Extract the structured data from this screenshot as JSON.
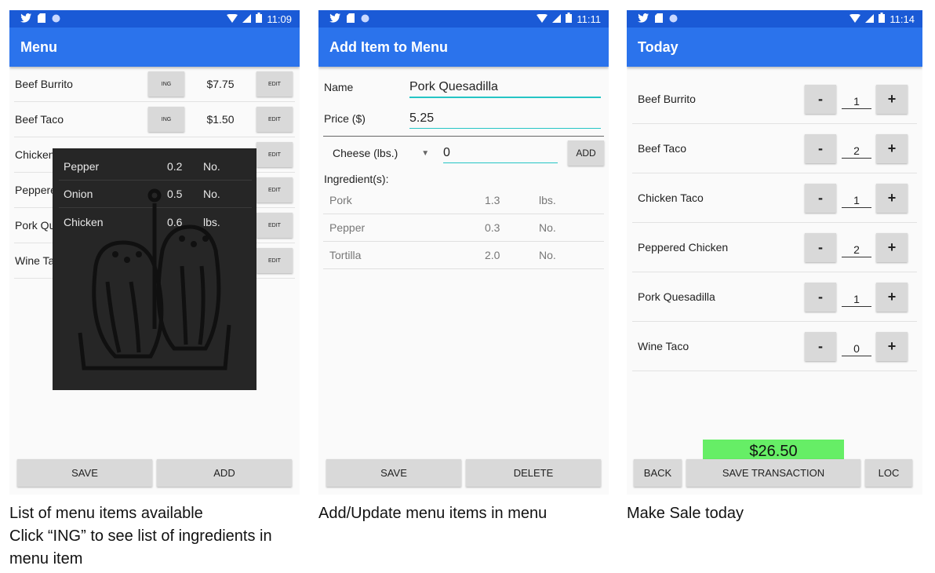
{
  "status_bar": {
    "clocks": [
      "11:09",
      "11:11",
      "11:14"
    ]
  },
  "screen_menu": {
    "title": "Menu",
    "items": [
      {
        "name": "Beef Burrito",
        "ing_label": "ING",
        "price": "$7.75",
        "edit_label": "EDIT"
      },
      {
        "name": "Beef Taco",
        "ing_label": "ING",
        "price": "$1.50",
        "edit_label": "EDIT"
      },
      {
        "name": "Chicken",
        "ing_label": "",
        "price": "",
        "edit_label": "EDIT"
      },
      {
        "name": "Peppere",
        "ing_label": "",
        "price": "",
        "edit_label": "EDIT"
      },
      {
        "name": "Pork Qu",
        "ing_label": "",
        "price": "",
        "edit_label": "EDIT"
      },
      {
        "name": "Wine Ta",
        "ing_label": "",
        "price": "",
        "edit_label": "EDIT"
      }
    ],
    "ingredient_popup": [
      {
        "name": "Pepper",
        "qty": "0.2",
        "unit": "No."
      },
      {
        "name": "Onion",
        "qty": "0.5",
        "unit": "No."
      },
      {
        "name": "Chicken",
        "qty": "0.6",
        "unit": "lbs."
      }
    ],
    "save_label": "SAVE",
    "add_label": "ADD"
  },
  "screen_add": {
    "title": "Add Item to Menu",
    "name_label": "Name",
    "name_value": "Pork Quesadilla",
    "price_label": "Price ($)",
    "price_value": "5.25",
    "ingredient_select": "Cheese (lbs.)",
    "ingredient_qty": "0",
    "add_label": "ADD",
    "ingredients_heading": "Ingredient(s):",
    "ingredients": [
      {
        "name": "Pork",
        "qty": "1.3",
        "unit": "lbs."
      },
      {
        "name": "Pepper",
        "qty": "0.3",
        "unit": "No."
      },
      {
        "name": "Tortilla",
        "qty": "2.0",
        "unit": "No."
      }
    ],
    "save_label": "SAVE",
    "delete_label": "DELETE"
  },
  "screen_today": {
    "title": "Today",
    "items": [
      {
        "name": "Beef Burrito",
        "qty": "1"
      },
      {
        "name": "Beef Taco",
        "qty": "2"
      },
      {
        "name": "Chicken Taco",
        "qty": "1"
      },
      {
        "name": "Peppered Chicken",
        "qty": "2"
      },
      {
        "name": "Pork Quesadilla",
        "qty": "1"
      },
      {
        "name": "Wine Taco",
        "qty": "0"
      }
    ],
    "minus_label": "-",
    "plus_label": "+",
    "total": "$26.50",
    "back_label": "BACK",
    "save_transaction_label": "SAVE TRANSACTION",
    "loc_label": "LOC"
  },
  "captions": {
    "menu_line1": "List of menu items available",
    "menu_line2": "Click “ING” to see list of ingredients in",
    "menu_line3": "menu item",
    "add": "Add/Update menu items in menu",
    "today": "Make Sale today"
  },
  "colors": {
    "status_bar": "#1a5ad6",
    "app_bar": "#2b73ec",
    "accent_underline": "#25c5c5",
    "total_bg": "#66ee66",
    "popup_bg": "#262626"
  },
  "icons": [
    "twitter-icon",
    "sd-card-icon",
    "circle-notification-icon",
    "wifi-icon",
    "signal-icon",
    "battery-icon"
  ]
}
